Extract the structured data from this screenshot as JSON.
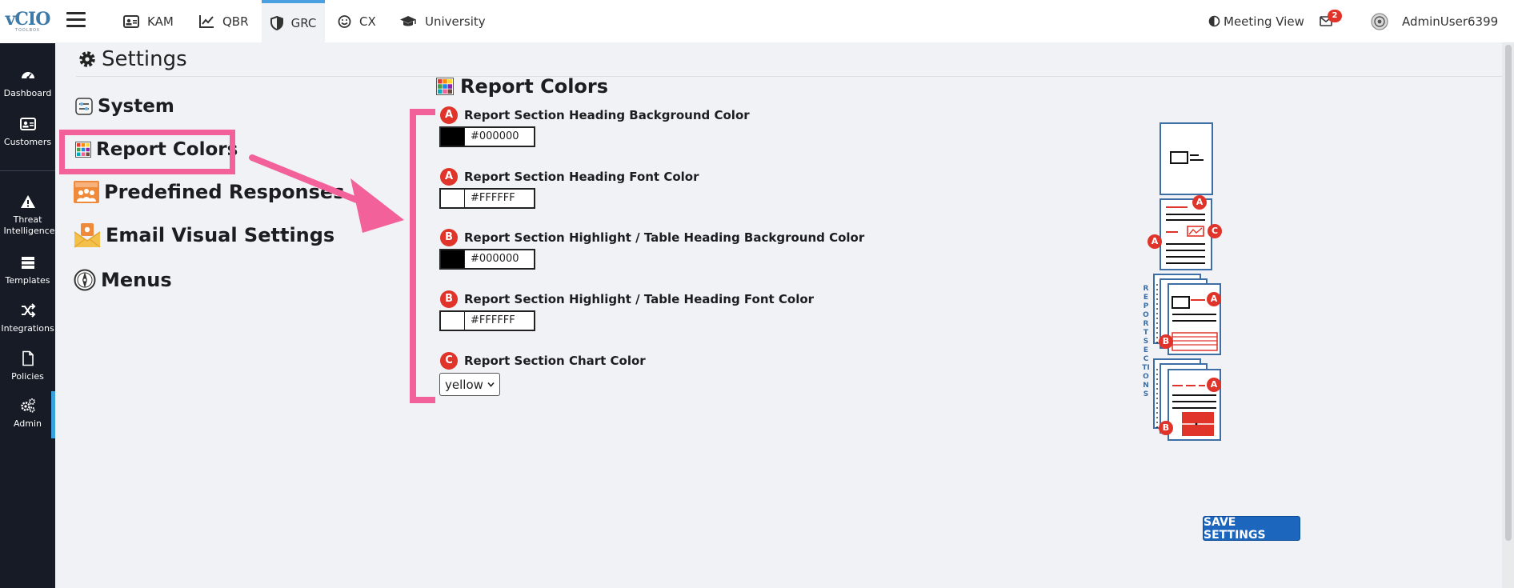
{
  "logo": {
    "main": "vCIO",
    "sub": "TOOLBOX"
  },
  "sidebar": {
    "items": [
      {
        "label": "Dashboard",
        "icon": "dashboard-icon"
      },
      {
        "label": "Customers",
        "icon": "id-card-icon"
      },
      {
        "label": "Threat Intelligence",
        "icon": "warning-icon"
      },
      {
        "label": "Templates",
        "icon": "stack-icon"
      },
      {
        "label": "Integrations",
        "icon": "shuffle-icon"
      },
      {
        "label": "Policies",
        "icon": "document-icon"
      },
      {
        "label": "Admin",
        "icon": "gears-icon"
      }
    ]
  },
  "topbar": {
    "tabs": [
      {
        "label": "KAM",
        "icon": "id-card-icon"
      },
      {
        "label": "QBR",
        "icon": "line-chart-icon"
      },
      {
        "label": "GRC",
        "icon": "shield-icon"
      },
      {
        "label": "CX",
        "icon": "smile-icon"
      },
      {
        "label": "University",
        "icon": "graduation-cap-icon"
      }
    ],
    "active_tab": "GRC",
    "meeting_view": "Meeting View",
    "mail_count": "2",
    "username": "AdminUser6399"
  },
  "page": {
    "title": "Settings"
  },
  "settings_menu": [
    {
      "label": "System"
    },
    {
      "label": "Report Colors"
    },
    {
      "label": "Predefined Responses"
    },
    {
      "label": "Email Visual Settings"
    },
    {
      "label": "Menus"
    }
  ],
  "form": {
    "title": "Report Colors",
    "fields": [
      {
        "marker": "A",
        "label": "Report Section Heading Background Color",
        "value": "#000000",
        "swatch": "#000000"
      },
      {
        "marker": "A",
        "label": "Report Section Heading Font Color",
        "value": "#FFFFFF",
        "swatch": "#FFFFFF"
      },
      {
        "marker": "B",
        "label": "Report Section Highlight / Table Heading Background Color",
        "value": "#000000",
        "swatch": "#000000"
      },
      {
        "marker": "B",
        "label": "Report Section Highlight / Table Heading Font Color",
        "value": "#FFFFFF",
        "swatch": "#FFFFFF"
      },
      {
        "marker": "C",
        "label": "Report Section Chart Color",
        "value": "yellow"
      }
    ],
    "save_label": "SAVE SETTINGS"
  },
  "diagram": {
    "markers": [
      "A",
      "A",
      "C",
      "A",
      "A",
      "B",
      "A",
      "B"
    ],
    "side_text": "REPORT SECTIONS"
  },
  "colors": {
    "sidebar_bg": "#161b26",
    "accent": "#4aa0e0",
    "annotation_pink": "#f2619a",
    "marker_red": "#e0342b",
    "diagram_blue": "#3d6fa6",
    "button_blue": "#1c66bd"
  }
}
